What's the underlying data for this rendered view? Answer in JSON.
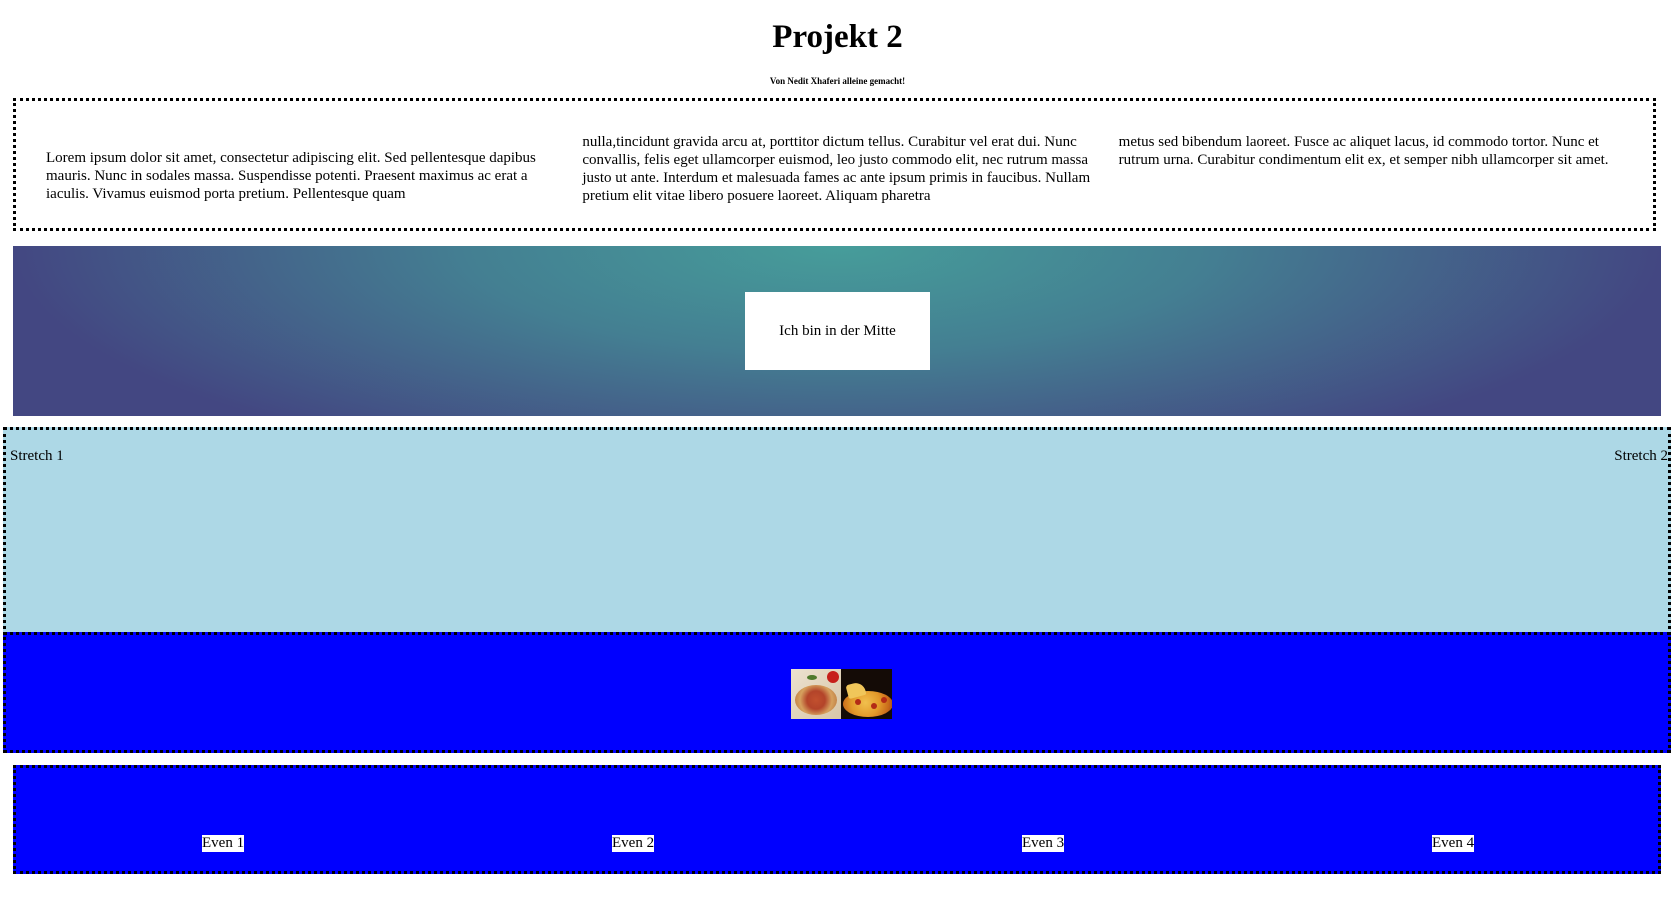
{
  "header": {
    "title": "Projekt 2",
    "subtitle": "Von Nedit Xhaferi alleine gemacht!"
  },
  "columns_section": {
    "paragraph": "Lorem ipsum dolor sit amet, consectetur adipiscing elit. Sed pellentesque dapibus mauris. Nunc in sodales massa. Suspendisse potenti. Praesent maximus ac erat a iaculis. Vivamus euismod porta pretium. Pellentesque quam nulla,tincidunt gravida arcu at, porttitor dictum tellus. Curabitur vel erat dui. Nunc convallis, felis eget ullamcorper euismod, leo justo commodo elit, nec rutrum massa justo ut ante. Interdum et malesuada fames ac ante ipsum primis in faucibus. Nullam pretium elit vitae libero posuere laoreet. Aliquam pharetra metus sed bibendum laoreet. Fusce ac aliquet lacus, id commodo tortor. Nunc et rutrum urna. Curabitur condimentum elit ex, et semper nibh ullamcorper sit amet.",
    "col1": "Lorem ipsum dolor sit amet, consectetur adipiscing elit. Sed pellentesque dapibus mauris. Nunc in sodales massa. Suspendisse potenti. Praesent maximus ac erat a iaculis. Vivamus euismod porta pretium. Pellentesque quam",
    "col2": "nulla,tincidunt gravida arcu at, porttitor dictum tellus. Curabitur vel erat dui. Nunc convallis, felis eget ullamcorper euismod, leo justo commodo elit, nec rutrum massa justo ut ante. Interdum et malesuada fames ac ante ipsum primis in faucibus. Nullam pretium elit vitae libero posuere laoreet. Aliquam pharetra",
    "col3": "metus sed bibendum laoreet. Fusce ac aliquet lacus, id commodo tortor. Nunc et rutrum urna. Curabitur condimentum elit ex, et semper nibh ullamcorper sit amet."
  },
  "center_section": {
    "label": "Ich bin in der Mitte",
    "gradient_center_color": "#469d9a",
    "gradient_edge_color": "#434782"
  },
  "stretch_section": {
    "background": "#add8e6",
    "item1": "Stretch 1",
    "item2": "Stretch 2"
  },
  "image_section": {
    "background": "#0000ff",
    "image_icon": "pizza-image"
  },
  "even_section": {
    "background": "#0000ff",
    "items": [
      "Even 1",
      "Even 2",
      "Even 3",
      "Even 4"
    ]
  }
}
